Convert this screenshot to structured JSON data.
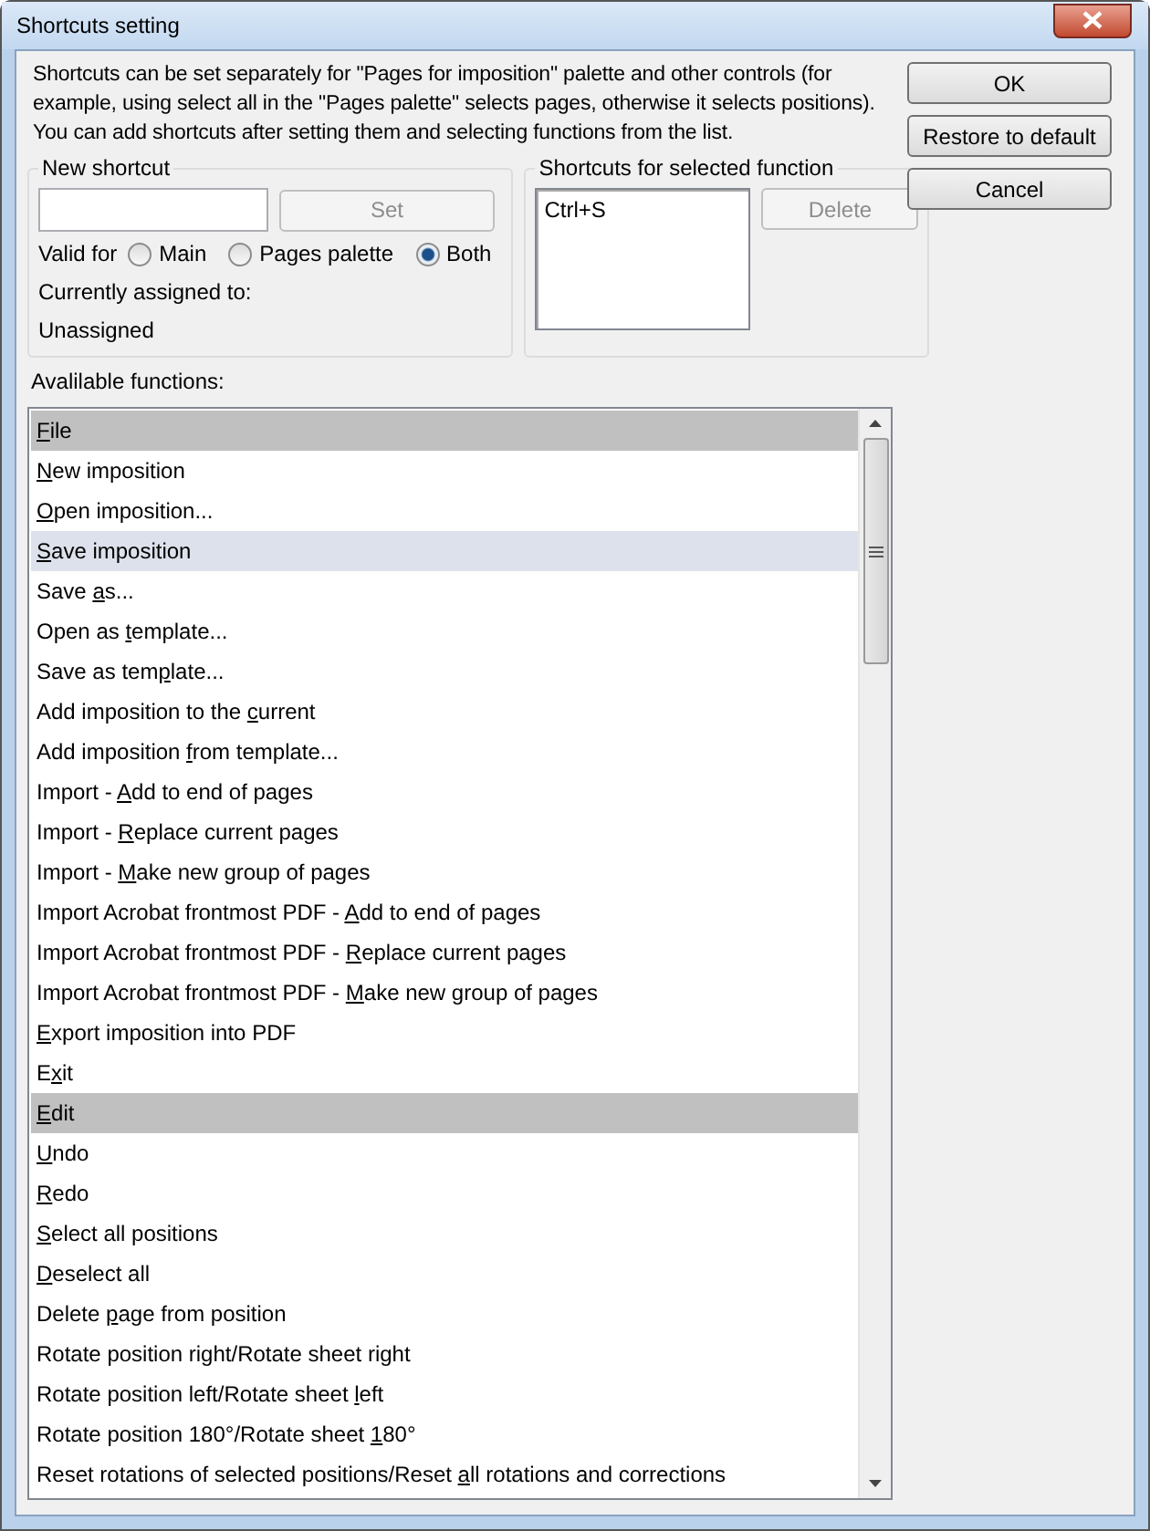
{
  "window": {
    "title": "Shortcuts setting"
  },
  "intro": "Shortcuts can be set separately for \"Pages for imposition\" palette and other controls (for example, using select all in the \"Pages palette\" selects pages, otherwise it selects positions). You can add shortcuts after setting them and selecting functions from the list.",
  "new_shortcut": {
    "title": "New shortcut",
    "set_button": {
      "label": "Set",
      "disabled": true
    },
    "valid_for_label": "Valid for",
    "options": [
      {
        "label": "Main",
        "selected": false
      },
      {
        "label": "Pages palette",
        "selected": false
      },
      {
        "label": "Both",
        "selected": true
      }
    ],
    "assigned_label": "Currently assigned to:",
    "assigned_value": "Unassigned"
  },
  "selected_function_shortcuts": {
    "title": "Shortcuts for selected function",
    "shortcuts": [
      "Ctrl+S"
    ],
    "delete_button": {
      "label": "Delete",
      "disabled": true
    }
  },
  "functions_label": "Avalilable functions:",
  "functions": [
    {
      "kind": "header",
      "key": "F",
      "post": "ile",
      "selected": false
    },
    {
      "kind": "function",
      "key": "N",
      "post": "ew imposition",
      "selected": false
    },
    {
      "kind": "function",
      "key": "O",
      "post": "pen imposition...",
      "selected": false
    },
    {
      "kind": "function",
      "key": "S",
      "post": "ave imposition",
      "selected": true
    },
    {
      "kind": "function",
      "pre": "Save ",
      "key": "a",
      "post": "s...",
      "selected": false
    },
    {
      "kind": "function",
      "pre": "Open as ",
      "key": "t",
      "post": "emplate...",
      "selected": false
    },
    {
      "kind": "function",
      "pre": "Save as tem",
      "key": "p",
      "post": "late...",
      "selected": false
    },
    {
      "kind": "function",
      "pre": "Add imposition to the ",
      "key": "c",
      "post": "urrent",
      "selected": false
    },
    {
      "kind": "function",
      "pre": "Add imposition ",
      "key": "f",
      "post": "rom template...",
      "selected": false
    },
    {
      "kind": "function",
      "pre": "Import - ",
      "key": "A",
      "post": "dd to end of pages",
      "selected": false
    },
    {
      "kind": "function",
      "pre": "Import - ",
      "key": "R",
      "post": "eplace current pages",
      "selected": false
    },
    {
      "kind": "function",
      "pre": "Import - ",
      "key": "M",
      "post": "ake new group of pages",
      "selected": false
    },
    {
      "kind": "function",
      "pre": "Import Acrobat frontmost PDF - ",
      "key": "A",
      "post": "dd to end of pages",
      "selected": false
    },
    {
      "kind": "function",
      "pre": "Import Acrobat frontmost PDF - ",
      "key": "R",
      "post": "eplace current pages",
      "selected": false
    },
    {
      "kind": "function",
      "pre": "Import Acrobat frontmost PDF - ",
      "key": "M",
      "post": "ake new group of pages",
      "selected": false
    },
    {
      "kind": "function",
      "key": "E",
      "post": "xport imposition into PDF",
      "selected": false
    },
    {
      "kind": "function",
      "pre": "E",
      "key": "x",
      "post": "it",
      "selected": false
    },
    {
      "kind": "header",
      "key": "E",
      "post": "dit",
      "selected": false
    },
    {
      "kind": "function",
      "key": "U",
      "post": "ndo",
      "selected": false
    },
    {
      "kind": "function",
      "key": "R",
      "post": "edo",
      "selected": false
    },
    {
      "kind": "function",
      "key": "S",
      "post": "elect all positions",
      "selected": false
    },
    {
      "kind": "function",
      "key": "D",
      "post": "eselect all",
      "selected": false
    },
    {
      "kind": "function",
      "pre": "Delete ",
      "key": "p",
      "post": "age from position",
      "selected": false
    },
    {
      "kind": "function",
      "pre": "Rotate position right/Rotate sheet ri",
      "key": "g",
      "post": "ht",
      "selected": false
    },
    {
      "kind": "function",
      "pre": "Rotate position left/Rotate sheet ",
      "key": "l",
      "post": "eft",
      "selected": false
    },
    {
      "kind": "function",
      "pre": "Rotate position 180°/Rotate sheet ",
      "key": "1",
      "post": "80°",
      "selected": false
    },
    {
      "kind": "function",
      "pre": "Reset rotations of selected positions/Reset ",
      "key": "a",
      "post": "ll rotations and corrections",
      "selected": false
    }
  ],
  "buttons": [
    "OK",
    "Restore to default",
    "Cancel"
  ]
}
